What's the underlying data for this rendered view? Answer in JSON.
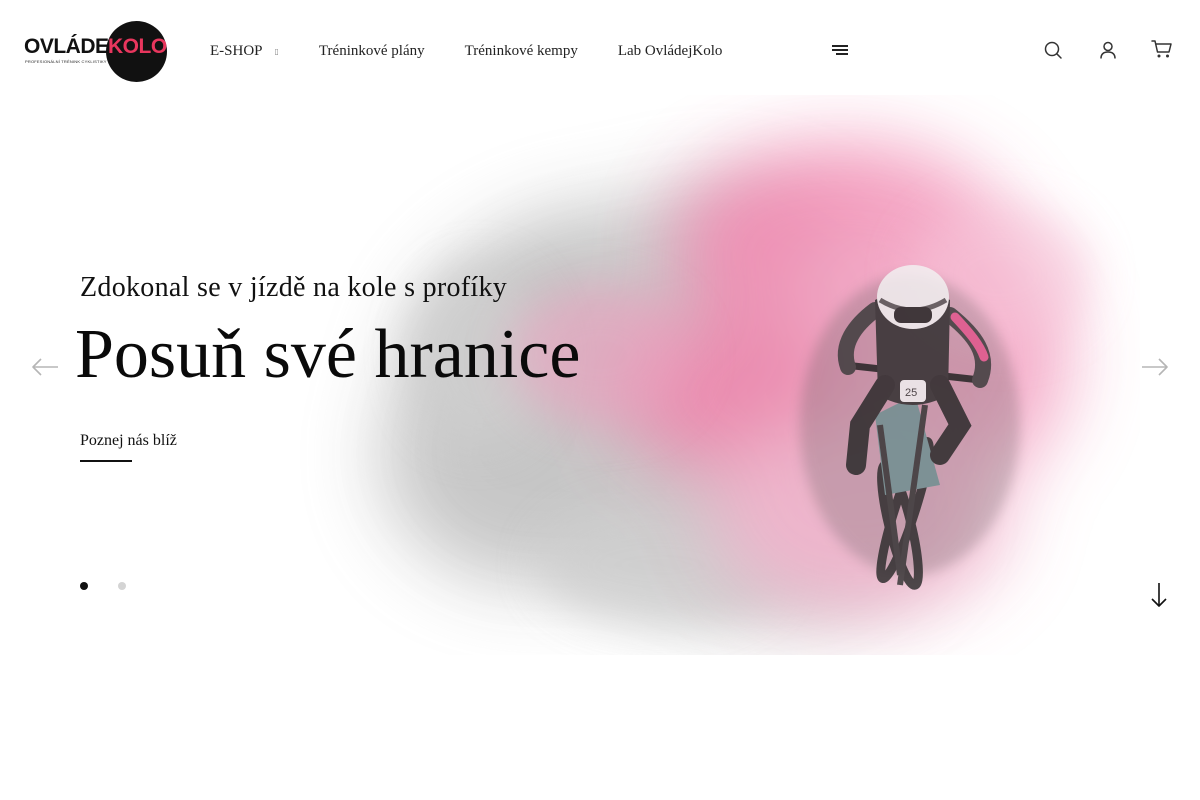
{
  "logo": {
    "text_left": "OVLÁDEJ",
    "text_right": "KOLO",
    "tagline": "Profesionální trénink cyklistiky",
    "accent_color": "#e8365d"
  },
  "nav": {
    "items": [
      {
        "label": "E-SHOP",
        "has_dropdown": true,
        "caret": "▯"
      },
      {
        "label": "Tréninkové plány"
      },
      {
        "label": "Tréninkové kempy"
      },
      {
        "label": "Lab OvládejKolo"
      }
    ]
  },
  "header_icons": [
    "menu-icon",
    "search-icon",
    "user-icon",
    "cart-icon"
  ],
  "hero": {
    "subtitle": "Zdokonal se v jízdě na kole s profíky",
    "title": "Posuň své hranice",
    "cta_label": "Poznej nás blíž",
    "slides_total": 2,
    "active_slide": 1
  },
  "colors": {
    "smoke_gray": "#b8b8b8",
    "smoke_pink": "#f07aa8",
    "text": "#111111"
  }
}
